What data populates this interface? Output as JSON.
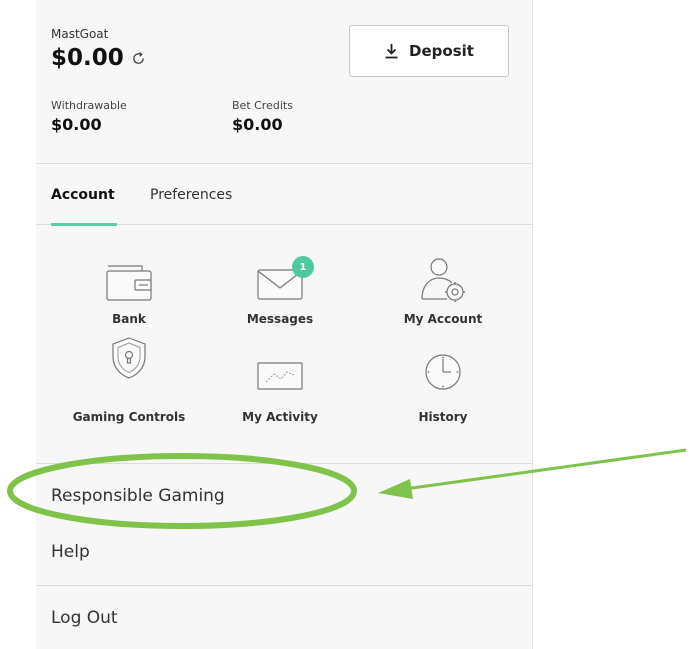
{
  "wallet": {
    "username": "MastGoat",
    "balance": "$0.00",
    "deposit_label": "Deposit",
    "withdrawable_label": "Withdrawable",
    "withdrawable_value": "$0.00",
    "bet_credits_label": "Bet Credits",
    "bet_credits_value": "$0.00"
  },
  "tabs": [
    {
      "label": "Account",
      "active": true
    },
    {
      "label": "Preferences",
      "active": false
    }
  ],
  "grid": {
    "items": [
      {
        "label": "Bank",
        "icon": "wallet-icon"
      },
      {
        "label": "Messages",
        "icon": "envelope-icon",
        "badge": "1"
      },
      {
        "label": "My Account",
        "icon": "user-gear-icon"
      },
      {
        "label": "Gaming Controls",
        "icon": "shield-lock-icon"
      },
      {
        "label": "My Activity",
        "icon": "activity-chart-icon"
      },
      {
        "label": "History",
        "icon": "clock-icon"
      }
    ]
  },
  "menu": {
    "responsible_gaming": "Responsible Gaming",
    "help": "Help",
    "logout": "Log Out"
  },
  "colors": {
    "accent": "#5ccfa2",
    "badge": "#4fcaa0",
    "annotation": "#7fc34a",
    "panel_bg": "#f7f7f7"
  }
}
